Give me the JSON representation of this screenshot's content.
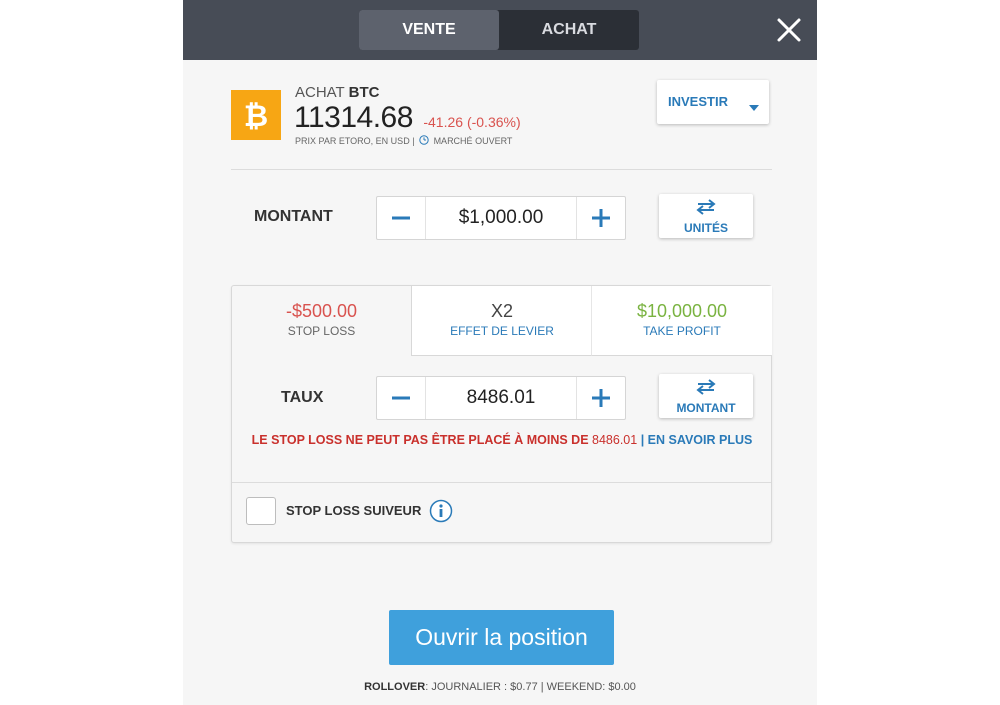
{
  "header": {
    "tab_sell": "VENTE",
    "tab_buy": "ACHAT",
    "close_icon": "close-icon"
  },
  "asset": {
    "action": "ACHAT",
    "symbol": "BTC",
    "price": "11314.68",
    "change": "-41.26 (-0.36%)",
    "price_source": "PRIX PAR ETORO, EN USD |",
    "market_status": "MARCHÉ OUVERT",
    "logo_color": "#f7a614",
    "logo_icon": "bitcoin-icon"
  },
  "invest_button": {
    "label": "INVESTIR",
    "icon": "caret-down-icon"
  },
  "amount": {
    "label": "MONTANT",
    "value": "$1,000.00",
    "minus": "−",
    "plus": "+",
    "switch_label": "UNITÉS"
  },
  "tabs": {
    "stop_loss": {
      "value": "-$500.00",
      "label": "STOP LOSS"
    },
    "leverage": {
      "value": "X2",
      "label": "EFFET DE LEVIER"
    },
    "take_profit": {
      "value": "$10,000.00",
      "label": "TAKE PROFIT"
    }
  },
  "rate": {
    "label": "TAUX",
    "value": "8486.01",
    "minus": "−",
    "plus": "+",
    "switch_label": "MONTANT"
  },
  "warning": {
    "text": "LE STOP LOSS NE PEUT PAS ÊTRE PLACÉ À MOINS DE",
    "value": "8486.01",
    "separator": "|",
    "link": "EN SAVOIR PLUS"
  },
  "trailing_stop": {
    "label": "STOP LOSS SUIVEUR",
    "checked": false
  },
  "open_button": {
    "label": "Ouvrir la position"
  },
  "rollover": {
    "label": "ROLLOVER",
    "text": ": JOURNALIER : $0.77 | WEEKEND: $0.00"
  },
  "colors": {
    "accent_blue": "#2a7ab8",
    "button_blue": "#3fa0dc",
    "negative_red": "#d9534f",
    "positive_green": "#7ab341",
    "header_bg": "#474c56"
  }
}
